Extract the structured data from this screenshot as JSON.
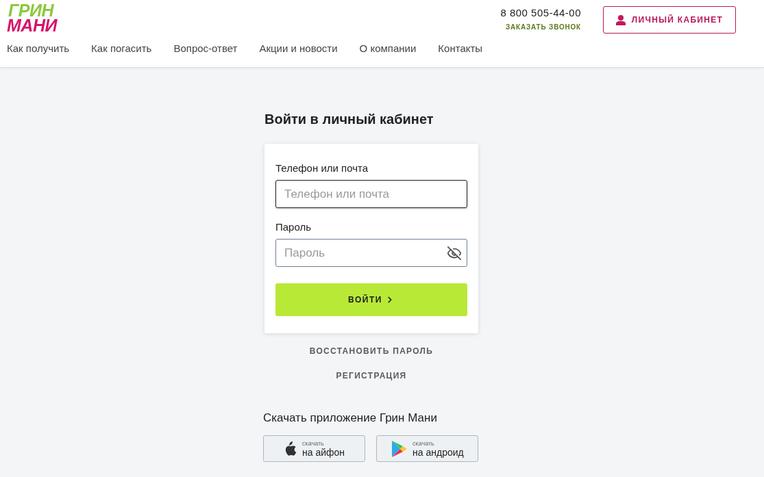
{
  "header": {
    "logo": [
      "ГРИН",
      "МАНИ"
    ],
    "nav": [
      "Как получить",
      "Как погасить",
      "Вопрос-ответ",
      "Акции и новости",
      "О компании",
      "Контакты"
    ],
    "phone": "8 800 505-44-00",
    "callback_link": "ЗАКАЗАТЬ ЗВОНОК",
    "account_button": "ЛИЧНЫЙ КАБИНЕТ"
  },
  "login": {
    "title": "Войти в личный кабинет",
    "fields": [
      {
        "kind": "text",
        "label": "Телефон или почта",
        "placeholder": "Телефон или почта",
        "focused": true
      },
      {
        "kind": "password",
        "label": "Пароль",
        "placeholder": "Пароль",
        "focused": false
      }
    ],
    "submit": "ВОЙТИ"
  },
  "links": [
    "ВОССТАНОВИТЬ ПАРОЛЬ",
    "РЕГИСТРАЦИЯ"
  ],
  "apps": {
    "title": "Скачать приложение Грин Мани",
    "buttons": [
      {
        "kind": "ios",
        "caption": "скачать",
        "label": "на айфон"
      },
      {
        "kind": "android",
        "caption": "скачать",
        "label": "на андроид"
      }
    ]
  }
}
